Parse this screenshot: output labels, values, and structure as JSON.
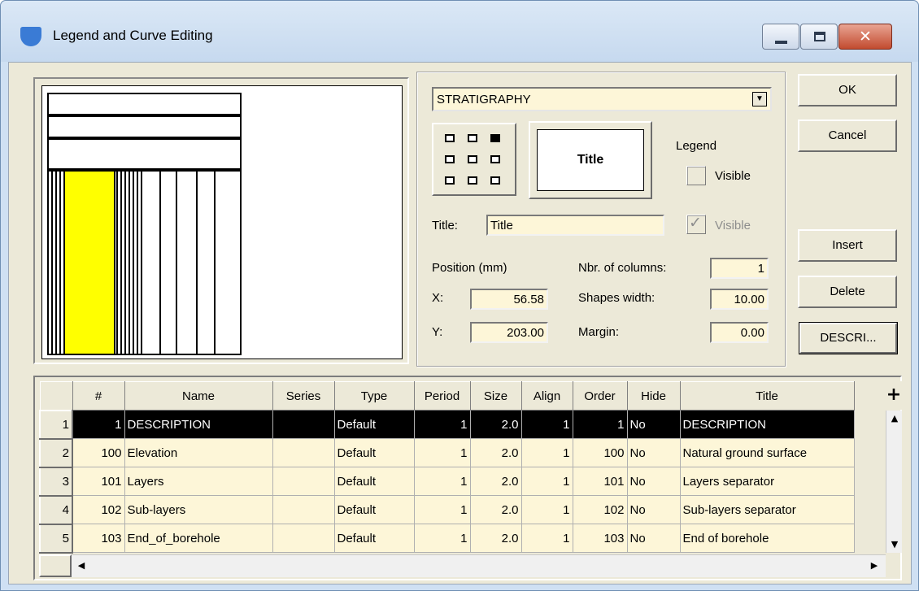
{
  "window": {
    "title": "Legend and Curve Editing"
  },
  "preview": {
    "fill_color": "#ffff00"
  },
  "properties": {
    "curve_select": "STRATIGRAPHY",
    "title_button_label": "Title",
    "legend_label": "Legend",
    "legend_visible_label": "Visible",
    "legend_visible_checked": false,
    "title_label": "Title:",
    "title_value": "Title",
    "title_visible_label": "Visible",
    "title_visible_checked": true,
    "position_label": "Position (mm)",
    "x_label": "X:",
    "x_value": "56.58",
    "y_label": "Y:",
    "y_value": "203.00",
    "columns_label": "Nbr. of columns:",
    "columns_value": "1",
    "shapes_width_label": "Shapes width:",
    "shapes_width_value": "10.00",
    "margin_label": "Margin:",
    "margin_value": "0.00"
  },
  "buttons": {
    "ok": "OK",
    "cancel": "Cancel",
    "insert": "Insert",
    "delete": "Delete",
    "descri": "DESCRI..."
  },
  "grid": {
    "columns": [
      "#",
      "Name",
      "Series",
      "Type",
      "Period",
      "Size",
      "Align",
      "Order",
      "Hide",
      "Title"
    ],
    "add_button": "+",
    "rows": [
      {
        "row": "1",
        "num": "1",
        "name": "DESCRIPTION",
        "series": "",
        "type": "Default",
        "period": "1",
        "size": "2.0",
        "align": "1",
        "order": "1",
        "hide": "No",
        "title": "DESCRIPTION"
      },
      {
        "row": "2",
        "num": "100",
        "name": "Elevation",
        "series": "",
        "type": "Default",
        "period": "1",
        "size": "2.0",
        "align": "1",
        "order": "100",
        "hide": "No",
        "title": "Natural ground surface"
      },
      {
        "row": "3",
        "num": "101",
        "name": "Layers",
        "series": "",
        "type": "Default",
        "period": "1",
        "size": "2.0",
        "align": "1",
        "order": "101",
        "hide": "No",
        "title": "Layers separator"
      },
      {
        "row": "4",
        "num": "102",
        "name": "Sub-layers",
        "series": "",
        "type": "Default",
        "period": "1",
        "size": "2.0",
        "align": "1",
        "order": "102",
        "hide": "No",
        "title": "Sub-layers separator"
      },
      {
        "row": "5",
        "num": "103",
        "name": "End_of_borehole",
        "series": "",
        "type": "Default",
        "period": "1",
        "size": "2.0",
        "align": "1",
        "order": "103",
        "hide": "No",
        "title": "End of borehole"
      }
    ]
  }
}
